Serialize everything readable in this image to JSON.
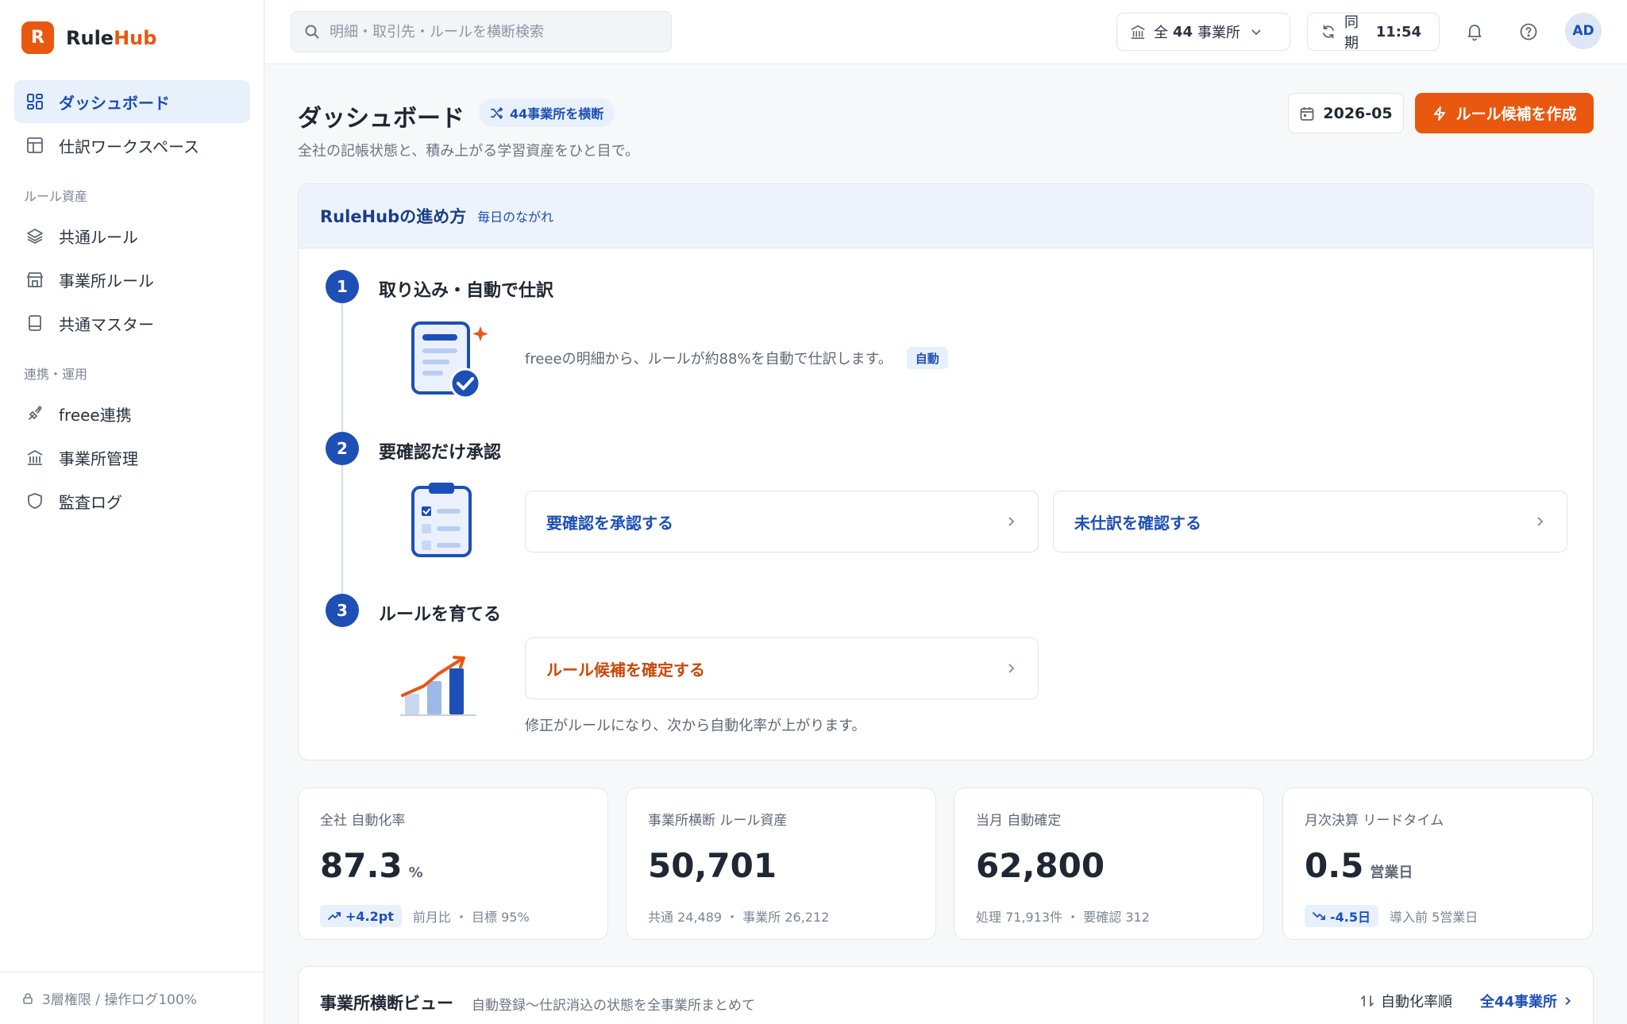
{
  "brand": {
    "mark": "R",
    "name_main": "Rule",
    "name_accent": "Hub"
  },
  "sidebar": {
    "items_main": [
      {
        "label": "ダッシュボード",
        "icon": "dashboard-icon",
        "active": true
      },
      {
        "label": "仕訳ワークスペース",
        "icon": "table-icon",
        "active": false
      }
    ],
    "section_rules": "ルール資産",
    "items_rules": [
      {
        "label": "共通ルール",
        "icon": "layers-icon"
      },
      {
        "label": "事業所ルール",
        "icon": "store-icon"
      },
      {
        "label": "共通マスター",
        "icon": "book-icon"
      }
    ],
    "section_ops": "連携・運用",
    "items_ops": [
      {
        "label": "freee連携",
        "icon": "plug-icon"
      },
      {
        "label": "事業所管理",
        "icon": "building-icon"
      },
      {
        "label": "監査ログ",
        "icon": "shield-icon"
      }
    ],
    "footer": "3層権限 / 操作ログ100%"
  },
  "header": {
    "search_placeholder": "明細・取引先・ルールを横断検索",
    "office_prefix": "全",
    "office_count": "44",
    "office_suffix": "事業所",
    "sync_label": "同期",
    "sync_time": "11:54",
    "avatar": "AD"
  },
  "page": {
    "title": "ダッシュボード",
    "badge": "44事業所を横断",
    "subtitle": "全社の記帳状態と、積み上がる学習資産をひと目で。",
    "month": "2026-05",
    "create_button": "ルール候補を作成"
  },
  "flow": {
    "title": "RuleHubの進め方",
    "subtitle": "毎日のながれ",
    "steps": [
      {
        "num": "1",
        "title": "取り込み・自動で仕訳",
        "desc": "freeeの明細から、ルールが約88%を自動で仕訳します。",
        "badge": "自動"
      },
      {
        "num": "2",
        "title": "要確認だけ承認",
        "action1": "要確認を承認する",
        "action2": "未仕訳を確認する"
      },
      {
        "num": "3",
        "title": "ルールを育てる",
        "action1": "ルール候補を確定する",
        "desc": "修正がルールになり、次から自動化率が上がります。"
      }
    ]
  },
  "stats": [
    {
      "label": "全社 自動化率",
      "value": "87.3",
      "unit": "%",
      "trend": "+4.2pt",
      "trend_dir": "up",
      "foot": "前月比 ・ 目標 95%"
    },
    {
      "label": "事業所横断 ルール資産",
      "value": "50,701",
      "unit": "",
      "foot": "共通 24,489 ・ 事業所 26,212"
    },
    {
      "label": "当月 自動確定",
      "value": "62,800",
      "unit": "",
      "foot": "処理 71,913件 ・ 要確認 312"
    },
    {
      "label": "月次決算 リードタイム",
      "value": "0.5",
      "unit": "営業日",
      "trend": "-4.5日",
      "trend_dir": "down",
      "foot": "導入前 5営業日"
    }
  ],
  "cross": {
    "title": "事業所横断ビュー",
    "subtitle": "自動登録〜仕訳消込の状態を全事業所まとめて",
    "sort": "自動化率順",
    "all_link": "全44事業所"
  },
  "colors": {
    "brand": "#e8580f",
    "primary": "#1d4fb6"
  }
}
